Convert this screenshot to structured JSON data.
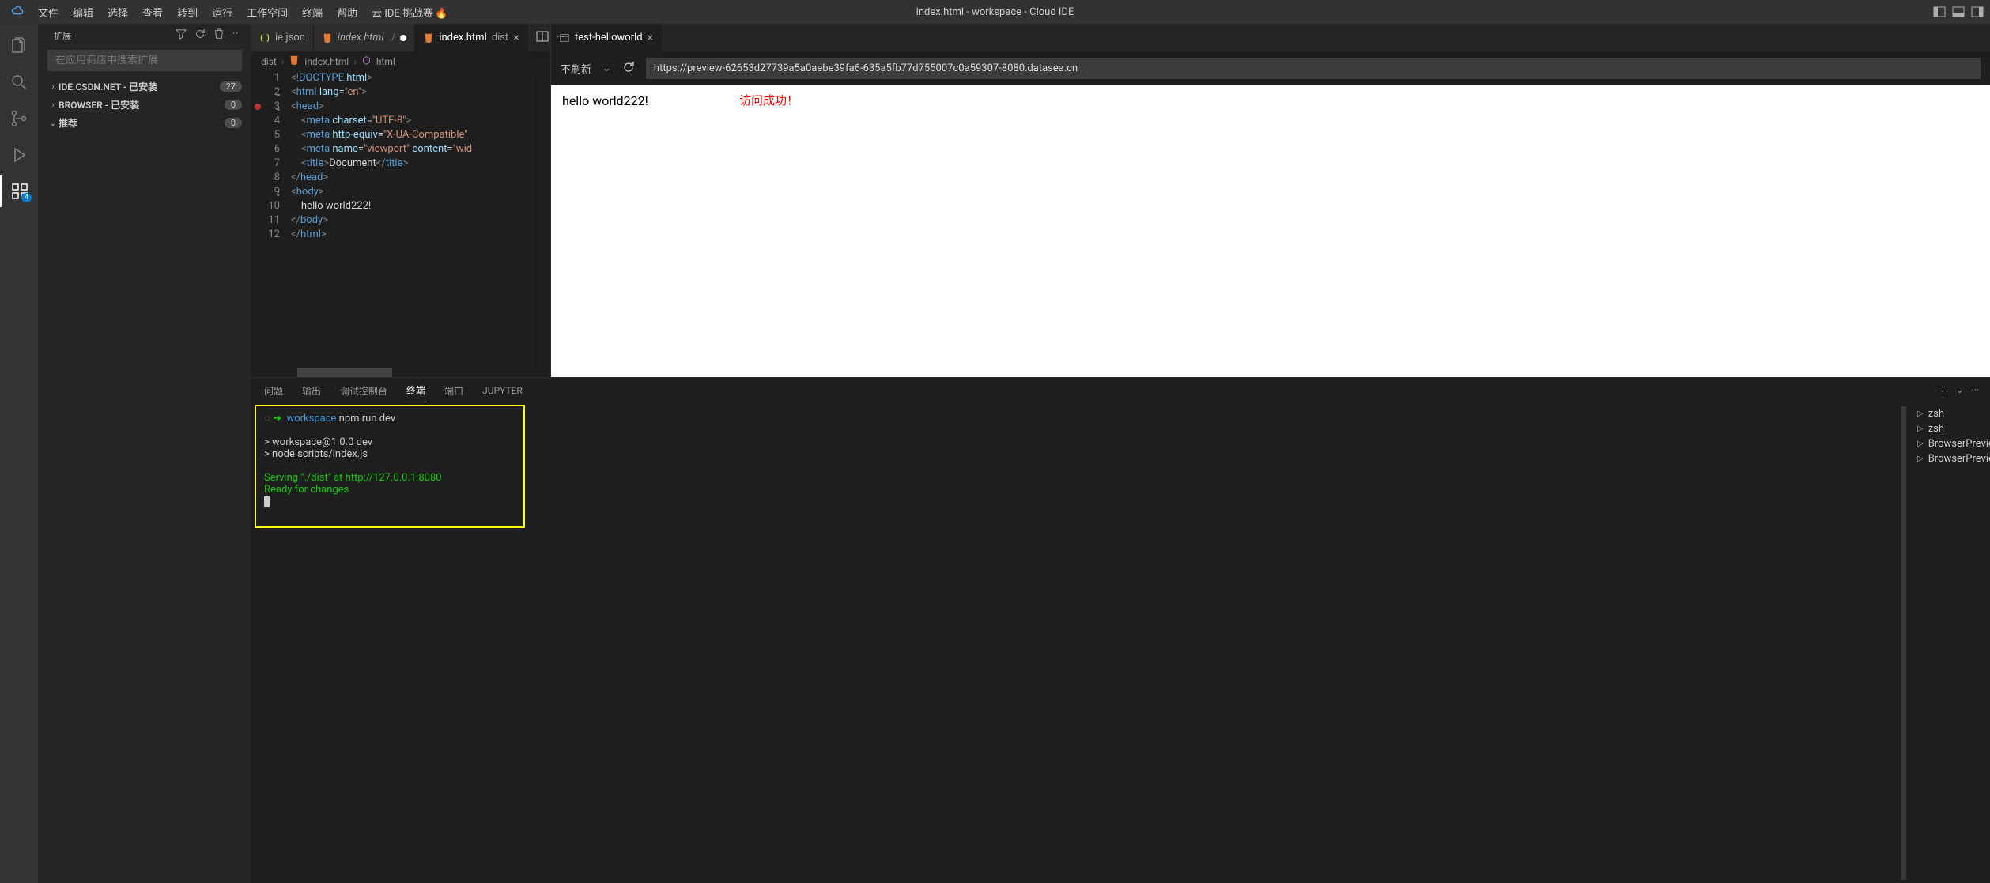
{
  "title": "index.html - workspace - Cloud IDE",
  "menu": [
    "文件",
    "编辑",
    "选择",
    "查看",
    "转到",
    "运行",
    "工作空间",
    "终端",
    "帮助",
    "云 IDE 挑战赛"
  ],
  "sidebar": {
    "title": "扩展",
    "search_placeholder": "在应用商店中搜索扩展",
    "sections": [
      {
        "label": "IDE.CSDN.NET - 已安装",
        "badge": "27",
        "expanded": false
      },
      {
        "label": "BROWSER - 已安装",
        "badge": "0",
        "expanded": false
      },
      {
        "label": "推荐",
        "badge": "0",
        "expanded": true
      }
    ]
  },
  "activity_badge": "4",
  "tabs_left": [
    {
      "label": "ie.json",
      "active": false,
      "icon": "json"
    },
    {
      "label": "index.html",
      "suffix": " ./",
      "active": false,
      "italic": true,
      "icon": "html"
    },
    {
      "label": "index.html",
      "suffix": " dist",
      "active": true,
      "icon": "html",
      "close": true
    }
  ],
  "tabs_preview": [
    {
      "label": "test-helloworld",
      "active": true,
      "close": true
    }
  ],
  "breadcrumb": [
    "dist",
    "index.html",
    "html"
  ],
  "code": {
    "lines": [
      {
        "n": 1,
        "html": "<span class='tok-punc'>&lt;!</span><span class='tok-doctype'>DOCTYPE</span> <span class='tok-attr'>html</span><span class='tok-punc'>&gt;</span>"
      },
      {
        "n": 2,
        "fold": "v",
        "html": "<span class='tok-punc'>&lt;</span><span class='tok-tag'>html</span> <span class='tok-attr'>lang</span>=<span class='tok-str'>\"en\"</span><span class='tok-punc'>&gt;</span>"
      },
      {
        "n": 3,
        "fold": "v",
        "dot": true,
        "html": "<span class='tok-punc'>&lt;</span><span class='tok-tag'>head</span><span class='tok-punc'>&gt;</span>"
      },
      {
        "n": 4,
        "html": "    <span class='tok-punc'>&lt;</span><span class='tok-tag'>meta</span> <span class='tok-attr'>charset</span>=<span class='tok-str'>\"UTF-8\"</span><span class='tok-punc'>&gt;</span>"
      },
      {
        "n": 5,
        "html": "    <span class='tok-punc'>&lt;</span><span class='tok-tag'>meta</span> <span class='tok-attr'>http-equiv</span>=<span class='tok-str'>\"X-UA-Compatible\"</span>"
      },
      {
        "n": 6,
        "html": "    <span class='tok-punc'>&lt;</span><span class='tok-tag'>meta</span> <span class='tok-attr'>name</span>=<span class='tok-str'>\"viewport\"</span> <span class='tok-attr'>content</span>=<span class='tok-str'>\"wid</span>"
      },
      {
        "n": 7,
        "html": "    <span class='tok-punc'>&lt;</span><span class='tok-tag'>title</span><span class='tok-punc'>&gt;</span>Document<span class='tok-punc'>&lt;/</span><span class='tok-tag'>title</span><span class='tok-punc'>&gt;</span>"
      },
      {
        "n": 8,
        "html": "<span class='tok-punc'>&lt;/</span><span class='tok-tag'>head</span><span class='tok-punc'>&gt;</span>"
      },
      {
        "n": 9,
        "fold": "v",
        "html": "<span class='tok-punc'>&lt;</span><span class='tok-tag'>body</span><span class='tok-punc'>&gt;</span>"
      },
      {
        "n": 10,
        "html": "    hello world222!"
      },
      {
        "n": 11,
        "html": "<span class='tok-punc'>&lt;/</span><span class='tok-tag'>body</span><span class='tok-punc'>&gt;</span>"
      },
      {
        "n": 12,
        "html": "<span class='tok-punc'>&lt;/</span><span class='tok-tag'>html</span><span class='tok-punc'>&gt;</span>"
      }
    ]
  },
  "preview": {
    "refresh_label": "不刷新",
    "url": "https://preview-62653d27739a5a0aebe39fa6-635a5fb77d755007c0a59307-8080.datasea.cn",
    "body": "hello world222!",
    "annotation": "访问成功！"
  },
  "panel": {
    "tabs": [
      "问题",
      "输出",
      "调试控制台",
      "终端",
      "端口",
      "JUPYTER"
    ],
    "active": "终端",
    "term_right": [
      "zsh",
      "zsh",
      "BrowserPreview",
      "BrowserPreview"
    ],
    "lines": [
      {
        "cls": "",
        "html": "<span style='color:#555'>○</span> <span class='term-arrow'>➜</span>  <span class='term-teal'>workspace</span> npm run dev"
      },
      {
        "cls": "",
        "html": " "
      },
      {
        "cls": "",
        "html": "&gt; workspace@1.0.0 dev"
      },
      {
        "cls": "",
        "html": "&gt; node scripts/index.js"
      },
      {
        "cls": "",
        "html": " "
      },
      {
        "cls": "term-green",
        "html": "Serving \"./dist\" at http://127.0.0.1:8080"
      },
      {
        "cls": "term-green",
        "html": "Ready for changes"
      }
    ]
  }
}
